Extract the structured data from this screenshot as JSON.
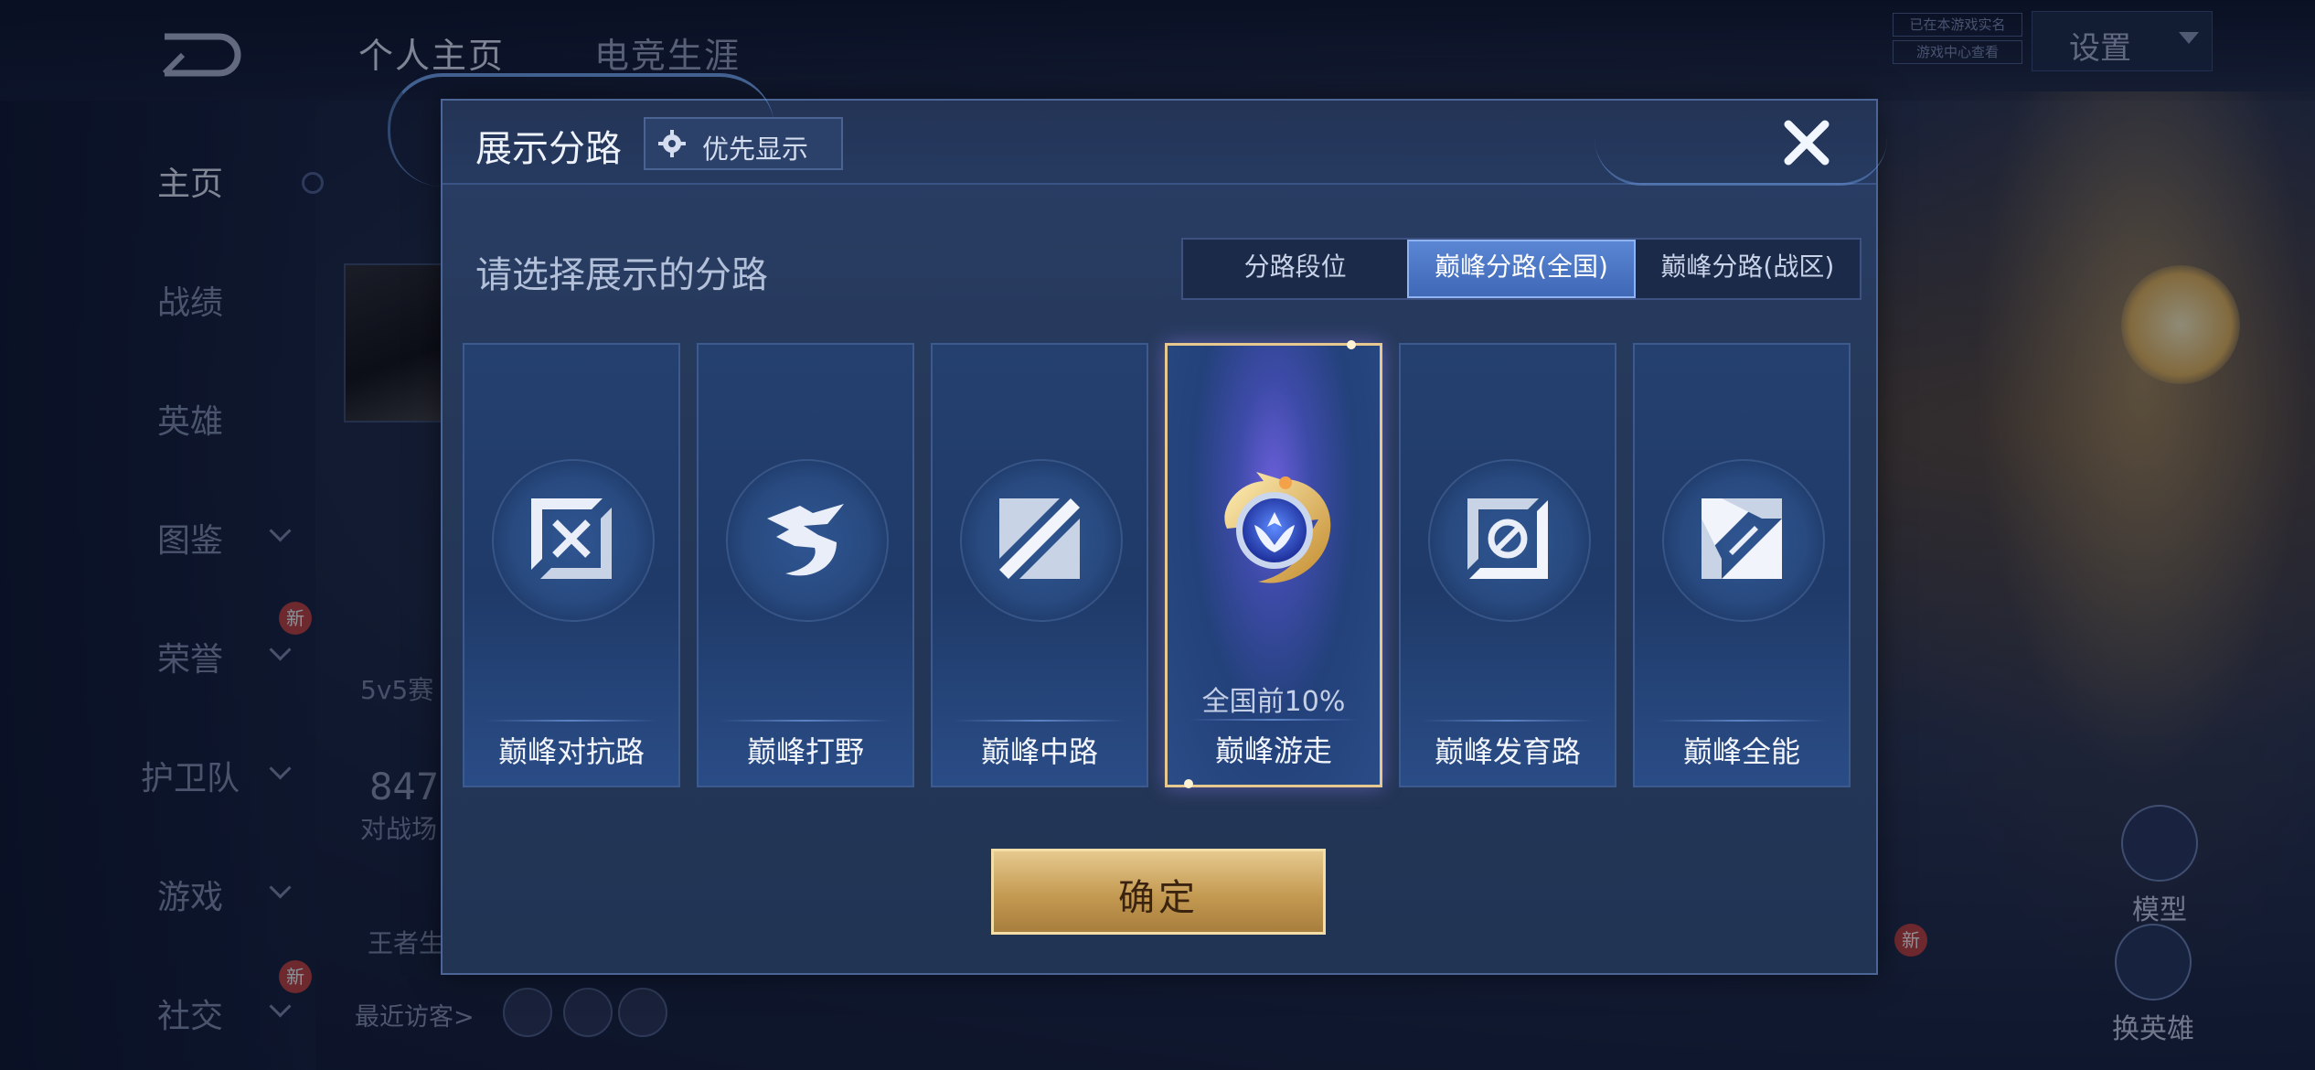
{
  "background": {
    "tabs": [
      "个人主页",
      "电竞生涯"
    ],
    "settings_label": "设置",
    "badges": [
      "已在本游戏实名",
      "游戏中心查看"
    ],
    "sidebar": [
      "主页",
      "战绩",
      "英雄",
      "图鉴",
      "荣誉",
      "护卫队",
      "游戏",
      "社交"
    ],
    "new_badge": "新",
    "mode_label": "5v5赛",
    "score_value": "847",
    "score_label": "对战场",
    "king_label": "王者生",
    "visitors_label": "最近访客>",
    "model_label": "模型",
    "switch_hero_label": "换英雄"
  },
  "modal": {
    "title": "展示分路",
    "priority_label": "优先显示",
    "subtitle": "请选择展示的分路",
    "segments": [
      "分路段位",
      "巅峰分路(全国)",
      "巅峰分路(战区)"
    ],
    "active_segment": 1,
    "cards": [
      {
        "name": "巅峰对抗路",
        "icon": "top-lane-icon"
      },
      {
        "name": "巅峰打野",
        "icon": "jungle-icon"
      },
      {
        "name": "巅峰中路",
        "icon": "mid-lane-icon"
      },
      {
        "name": "巅峰游走",
        "icon": "roam-icon",
        "rank": "全国前10%",
        "selected": true
      },
      {
        "name": "巅峰发育路",
        "icon": "bot-lane-icon"
      },
      {
        "name": "巅峰全能",
        "icon": "all-round-icon"
      }
    ],
    "confirm_label": "确定"
  },
  "colors": {
    "accent_gold": "#e7c98f",
    "active_tab": "#4a75c4",
    "modal_bg": "#253859"
  }
}
